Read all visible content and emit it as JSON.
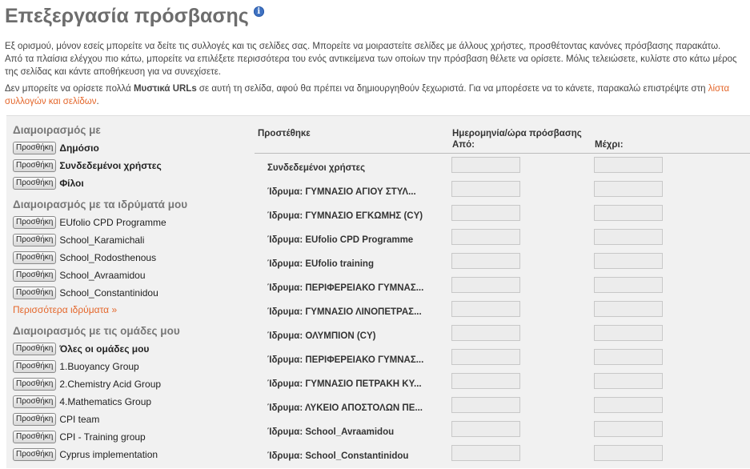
{
  "page": {
    "title": "Επεξεργασία πρόσβασης",
    "info_icon": "i",
    "intro_line1": "Εξ ορισμού, μόνον εσείς μπορείτε να δείτε τις συλλογές και τις σελίδες σας. Μπορείτε να μοιραστείτε σελίδες με άλλους χρήστες, προσθέτοντας κανόνες πρόσβασης παρακάτω.",
    "intro_line2": "Από τα πλαίσια ελέγχου πιο κάτω, μπορείτε να επιλέξετε περισσότερα του ενός αντικείμενα των οποίων την πρόσβαση θέλετε να ορίσετε. Μόλις τελειώσετε, κυλίστε στο κάτω μέρος",
    "intro_line3": "της σελίδας και κάντε αποθήκευση για να συνεχίσετε.",
    "secret_part1": "Δεν μπορείτε να ορίσετε πολλά ",
    "secret_bold": "Μυστικά URLs",
    "secret_part2": " σε αυτή τη σελίδα, αφού θα πρέπει να δημιουργηθούν ξεχωριστά. Για να μπορέσετε να το κάνετε, παρακαλώ επιστρέψτε στη ",
    "secret_link": "λίστα συλλογών και σελίδων",
    "secret_end": "."
  },
  "left": {
    "add_label": "Προσθήκη",
    "share_with": "Διαμοιρασμός με",
    "share_items": [
      "Δημόσιο",
      "Συνδεδεμένοι χρήστες",
      "Φίλοι"
    ],
    "institutions_heading": "Διαμοιρασμός με τα ιδρύματά μου",
    "institutions": [
      "EUfolio CPD Programme",
      "School_Karamichali",
      "School_Rodosthenous",
      "School_Avraamidou",
      "School_Constantinidou"
    ],
    "more_institutions": "Περισσότερα ιδρύματα »",
    "groups_heading": "Διαμοιρασμός με τις ομάδες μου",
    "groups": [
      "Όλες οι ομάδες μου",
      "1.Buoyancy Group",
      "2.Chemistry Acid Group",
      "4.Mathematics Group",
      "CPI team",
      "CPI - Training group",
      "Cyprus implementation"
    ]
  },
  "table": {
    "col_added": "Προστέθηκε",
    "col_datetime": "Ημερομηνία/ώρα πρόσβασης",
    "col_from": "Από:",
    "col_to": "Μέχρι:",
    "rows": [
      "Συνδεδεμένοι χρήστες",
      "Ίδρυμα: ΓΥΜΝΑΣΙΟ ΑΓΙΟΥ ΣΤΥΛ...",
      "Ίδρυμα: ΓΥΜΝΑΣΙΟ ΕΓΚΩΜΗΣ (CY)",
      "Ίδρυμα: EUfolio CPD Programme",
      "Ίδρυμα: EUfolio training",
      "Ίδρυμα: ΠΕΡΙΦΕΡΕΙΑΚΟ ΓΥΜΝΑΣ...",
      "Ίδρυμα: ΓΥΜΝΑΣΙΟ ΛΙΝΟΠΕΤΡΑΣ...",
      "Ίδρυμα: ΟΛΥΜΠΙΟΝ (CY)",
      "Ίδρυμα: ΠΕΡΙΦΕΡΕΙΑΚΟ ΓΥΜΝΑΣ...",
      "Ίδρυμα: ΓΥΜΝΑΣΙΟ ΠΕΤΡΑΚΗ ΚΥ...",
      "Ίδρυμα: ΛΥΚΕΙΟ ΑΠΟΣΤΟΛΩΝ ΠΕ...",
      "Ίδρυμα: School_Avraamidou",
      "Ίδρυμα: School_Constantinidou"
    ]
  },
  "colors": {
    "link": "#e4662a",
    "title": "#6d6d6d",
    "panel": "#f1f1f1"
  }
}
